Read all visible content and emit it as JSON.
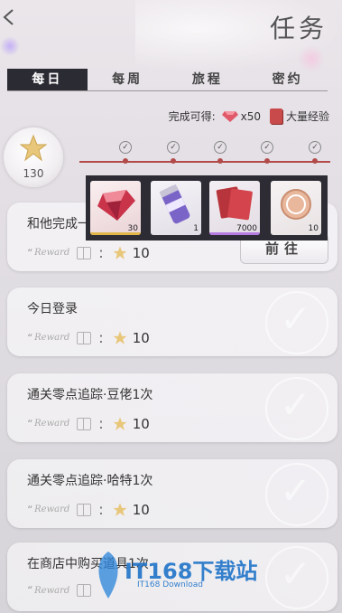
{
  "header": {
    "title": "任务"
  },
  "tabs": [
    {
      "label": "每日",
      "active": true
    },
    {
      "label": "每周",
      "active": false
    },
    {
      "label": "旅程",
      "active": false
    },
    {
      "label": "密约",
      "active": false
    }
  ],
  "completion": {
    "label": "完成可得:",
    "gem_amount": "x50",
    "exp_label": "大量经验"
  },
  "stars": {
    "count": "130"
  },
  "milestones": [
    {
      "checked": true
    },
    {
      "checked": true
    },
    {
      "checked": true
    },
    {
      "checked": true
    },
    {
      "checked": true
    }
  ],
  "popup_rewards": [
    {
      "icon": "gem-icon",
      "count": "30",
      "accent": "#e0b64a"
    },
    {
      "icon": "drink-can-icon",
      "count": "1",
      "accent": "#ffffff"
    },
    {
      "icon": "exp-card-icon",
      "count": "7000",
      "accent": "#b57be0"
    },
    {
      "icon": "coin-icon",
      "count": "10",
      "accent": "#ffffff"
    }
  ],
  "tasks": [
    {
      "name": "和他完成一",
      "reward_label": "Reward",
      "reward_value": "10",
      "action": "前往"
    },
    {
      "name": "今日登录",
      "reward_label": "Reward",
      "reward_value": "10"
    },
    {
      "name": "通关零点追踪·豆佬1次",
      "reward_label": "Reward",
      "reward_value": "10"
    },
    {
      "name": "通关零点追踪·哈特1次",
      "reward_label": "Reward",
      "reward_value": "10"
    },
    {
      "name": "在商店中购买道具1次",
      "reward_label": "Reward",
      "reward_value": "10"
    }
  ],
  "watermark": {
    "text": "IT168下载站",
    "sub": "IT168 Download"
  },
  "colors": {
    "accent": "#b34a4a",
    "tab_active": "#2b2b34",
    "popup_bg": "#2d2b33"
  }
}
